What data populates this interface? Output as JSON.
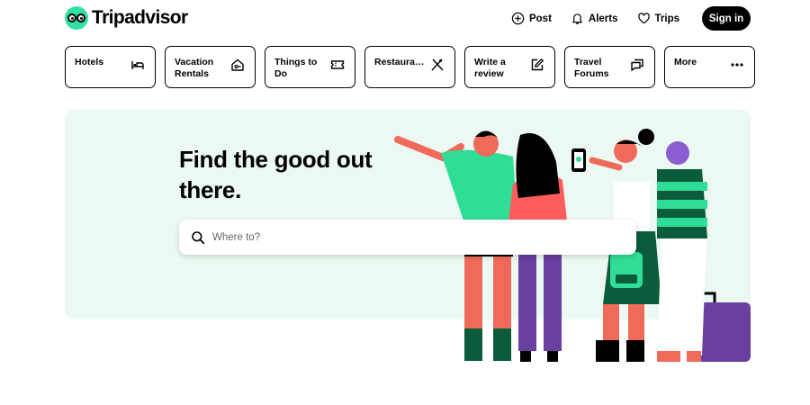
{
  "brand": {
    "name": "Tripadvisor",
    "accent": "#34e0a1"
  },
  "header": {
    "links": [
      {
        "label": "Post",
        "icon": "plus-circle-icon"
      },
      {
        "label": "Alerts",
        "icon": "bell-icon"
      },
      {
        "label": "Trips",
        "icon": "heart-icon"
      }
    ],
    "signin_label": "Sign in"
  },
  "categories": [
    {
      "label": "Hotels",
      "icon": "bed-icon"
    },
    {
      "label": "Vacation\nRentals",
      "icon": "house-key-icon"
    },
    {
      "label": "Things to\nDo",
      "icon": "ticket-icon"
    },
    {
      "label": "Restaura…",
      "icon": "fork-knife-icon"
    },
    {
      "label": "Write a\nreview",
      "icon": "edit-icon"
    },
    {
      "label": "Travel\nForums",
      "icon": "chat-bubbles-icon"
    },
    {
      "label": "More",
      "icon": "more-dots-icon"
    }
  ],
  "hero": {
    "title": "Find the good out there.",
    "search_placeholder": "Where to?",
    "background": "#ebf9f2"
  }
}
